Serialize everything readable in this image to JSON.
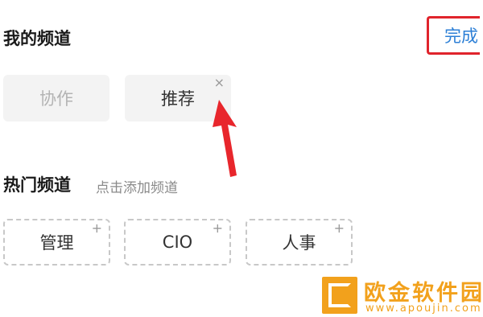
{
  "my_channels": {
    "title": "我的频道",
    "done_label": "完成",
    "items": [
      {
        "label": "协作",
        "removable": false
      },
      {
        "label": "推荐",
        "removable": true,
        "remove_icon": "×"
      }
    ]
  },
  "hot_channels": {
    "title": "热门频道",
    "hint": "点击添加频道",
    "add_icon": "+",
    "items": [
      "管理",
      "CIO",
      "人事"
    ]
  },
  "watermark": {
    "name": "欧金软件园",
    "url": "www.apoujin.com"
  },
  "colors": {
    "accent_link": "#2c7fd6",
    "highlight_box": "#e0242c",
    "arrow": "#e8262c",
    "watermark": "#f2a11c"
  }
}
